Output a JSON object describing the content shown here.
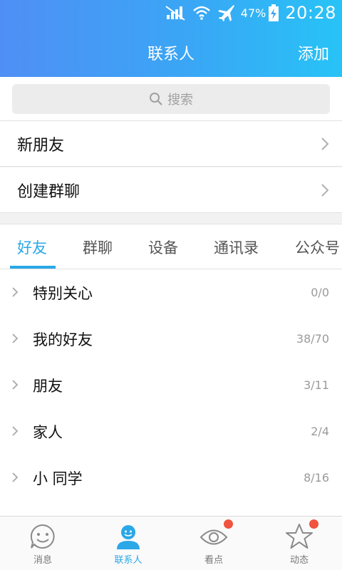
{
  "status": {
    "battery_percent": "47%",
    "time": "20:28",
    "icons": [
      "no-signal-icon",
      "wifi-icon",
      "airplane-icon",
      "battery-charging-icon"
    ]
  },
  "header": {
    "title": "联系人",
    "add_label": "添加"
  },
  "search": {
    "placeholder": "搜索"
  },
  "menu": [
    {
      "label": "新朋友"
    },
    {
      "label": "创建群聊"
    }
  ],
  "tabs": [
    {
      "label": "好友",
      "active": true
    },
    {
      "label": "群聊"
    },
    {
      "label": "设备"
    },
    {
      "label": "通讯录"
    },
    {
      "label": "公众号"
    }
  ],
  "groups": [
    {
      "name": "特别关心",
      "count": "0/0"
    },
    {
      "name": "我的好友",
      "count": "38/70"
    },
    {
      "name": "朋友",
      "count": "3/11"
    },
    {
      "name": "家人",
      "count": "2/4"
    },
    {
      "name": "小 同学",
      "count": "8/16"
    }
  ],
  "nav": [
    {
      "label": "消息",
      "icon": "smiley-icon"
    },
    {
      "label": "联系人",
      "icon": "person-icon",
      "active": true
    },
    {
      "label": "看点",
      "icon": "eye-icon"
    },
    {
      "label": "动态",
      "icon": "star-icon"
    }
  ],
  "colors": {
    "accent": "#2aa8e8",
    "header_gradient_start": "#4f8ff5",
    "header_gradient_end": "#27c3f6",
    "badge": "#f0533f"
  }
}
